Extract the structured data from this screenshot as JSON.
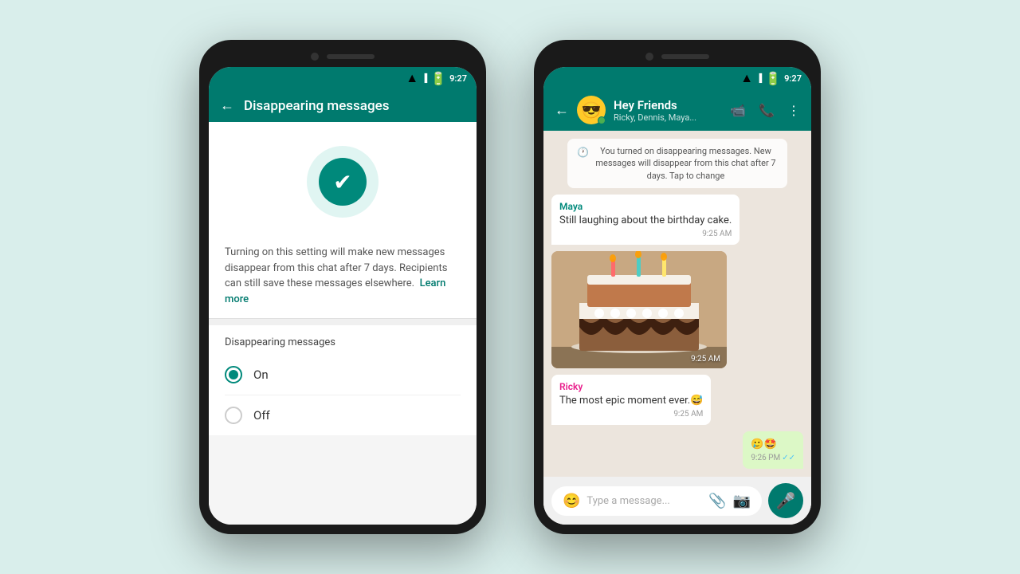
{
  "background": "#d9eeeb",
  "phone1": {
    "status_time": "9:27",
    "toolbar_title": "Disappearing messages",
    "back_arrow": "←",
    "description": "Turning on this setting will make new messages disappear from this chat after 7 days. Recipients can still save these messages elsewhere.",
    "learn_more": "Learn more",
    "section_label": "Disappearing messages",
    "radio_on_label": "On",
    "radio_off_label": "Off",
    "radio_on_selected": true
  },
  "phone2": {
    "status_time": "9:27",
    "chat_name": "Hey Friends",
    "chat_subtitle": "Ricky, Dennis, Maya...",
    "system_message": "You turned on disappearing messages. New messages will disappear from this chat after 7 days. Tap to change",
    "messages": [
      {
        "type": "received",
        "sender": "Maya",
        "text": "Still laughing about the birthday cake.",
        "time": "9:25 AM"
      },
      {
        "type": "image",
        "time": "9:25 AM"
      },
      {
        "type": "received",
        "sender": "Ricky",
        "text": "The most epic moment ever.😅",
        "time": "9:25 AM"
      },
      {
        "type": "sent",
        "text": "🥲🤩",
        "time": "9:26 PM",
        "ticks": "✓✓"
      }
    ],
    "input_placeholder": "Type a message...",
    "mic_icon": "🎤",
    "emoji_icon": "😊",
    "attach_icon": "📎",
    "camera_icon": "📷"
  }
}
